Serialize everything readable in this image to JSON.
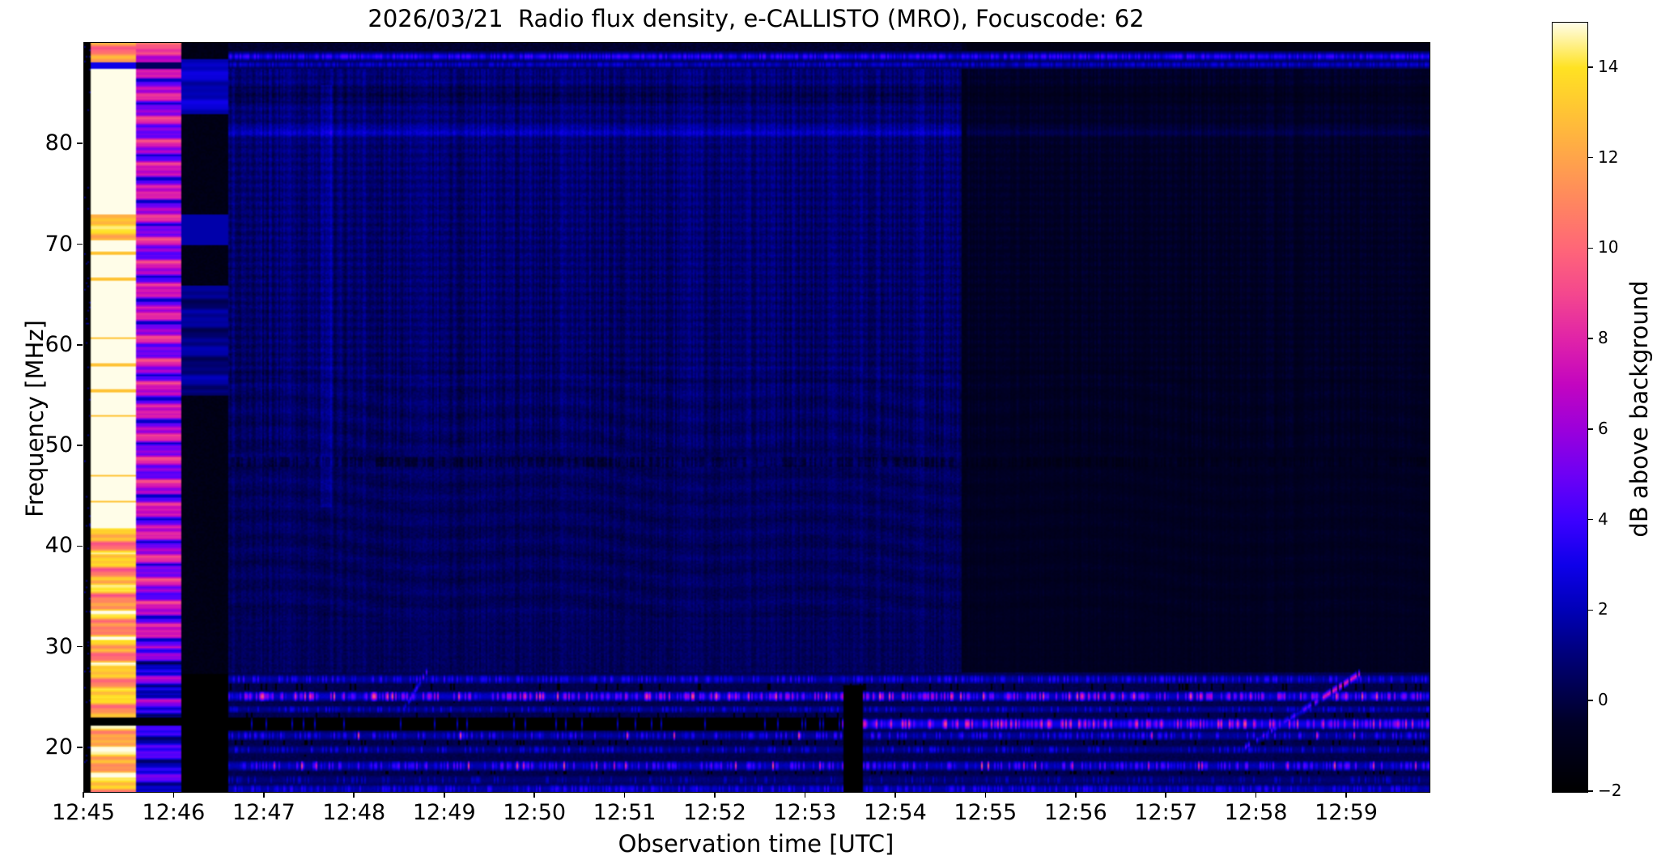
{
  "figure": {
    "title": "2026/03/21  Radio flux density, e-CALLISTO (MRO), Focuscode: 62",
    "xlabel": "Observation time [UTC]",
    "ylabel": "Frequency [MHz]"
  },
  "chart_data": {
    "type": "heatmap",
    "subtype": "radio-spectrogram",
    "title": "2026/03/21  Radio flux density, e-CALLISTO (MRO), Focuscode: 62",
    "xlabel": "Observation time [UTC]",
    "ylabel": "Frequency [MHz]",
    "x_ticks": [
      "12:45",
      "12:46",
      "12:47",
      "12:48",
      "12:49",
      "12:50",
      "12:51",
      "12:52",
      "12:53",
      "12:54",
      "12:55",
      "12:56",
      "12:57",
      "12:58",
      "12:59"
    ],
    "x_start": "12:45:00",
    "x_end": "12:59:56",
    "x_span_minutes": 14.93,
    "y_ticks": [
      20,
      30,
      40,
      50,
      60,
      70,
      80
    ],
    "ylim_mhz": [
      15.7,
      90.1
    ],
    "grid": false,
    "colorbar": {
      "label": "dB above background",
      "ticks": [
        14,
        12,
        10,
        8,
        6,
        4,
        2,
        0,
        -2
      ],
      "vmin": -2,
      "vmax": 15,
      "colormap": [
        {
          "v": -2.0,
          "c": "#000000"
        },
        {
          "v": -0.5,
          "c": "#000026"
        },
        {
          "v": 0.0,
          "c": "#000041"
        },
        {
          "v": 1.0,
          "c": "#000078"
        },
        {
          "v": 2.0,
          "c": "#0000b6"
        },
        {
          "v": 3.0,
          "c": "#0e00e9"
        },
        {
          "v": 4.0,
          "c": "#3c00ff"
        },
        {
          "v": 5.0,
          "c": "#6d00f5"
        },
        {
          "v": 6.0,
          "c": "#9b00db"
        },
        {
          "v": 7.0,
          "c": "#c305c0"
        },
        {
          "v": 8.0,
          "c": "#e023a8"
        },
        {
          "v": 9.0,
          "c": "#f4478e"
        },
        {
          "v": 10.0,
          "c": "#ff6678"
        },
        {
          "v": 11.0,
          "c": "#ff8560"
        },
        {
          "v": 12.0,
          "c": "#ffa44a"
        },
        {
          "v": 13.0,
          "c": "#ffc335"
        },
        {
          "v": 14.0,
          "c": "#ffe222"
        },
        {
          "v": 15.0,
          "c": "#fffde8"
        }
      ]
    },
    "features": {
      "edge_black_strip": {
        "t0": 0.0,
        "t1": 0.08,
        "db": -2
      },
      "calibration_columns": [
        {
          "t0": 0.08,
          "t1": 0.574,
          "kind": "saturated",
          "db_range": [
            9,
            15
          ],
          "note": "white/yellow banded column"
        },
        {
          "t0": 0.574,
          "t1": 1.077,
          "kind": "warm",
          "db_range": [
            2.5,
            11
          ],
          "note": "pink/magenta banded column"
        },
        {
          "t0": 1.077,
          "t1": 1.607,
          "kind": "dark",
          "db_range": [
            -2,
            2.4
          ],
          "note": "near-black column with blue bands"
        }
      ],
      "cal_black_gap_mhz": [
        22.3,
        23.15
      ],
      "background_db": {
        "low_freq": 0.2,
        "high_freq": 0.9
      },
      "dim_after_min": 9.79,
      "dim_factor": 0.52,
      "seam": {
        "t0": 9.73,
        "t1": 9.8,
        "db": -1.1
      },
      "top_lines": [
        {
          "f": 88.75,
          "w": 0.35,
          "amp": 3.3
        },
        {
          "f": 87.95,
          "w": 0.3,
          "amp": 2.2
        }
      ],
      "dark_band_mhz": {
        "f0": 84.2,
        "f1": 85.8,
        "delta": -0.55
      },
      "line_813": {
        "f": 81.3,
        "w": 0.5,
        "amp": 1.3
      },
      "dotted_dark_line_mhz": 48.5,
      "vertical_streak": {
        "t0": 2.62,
        "t1": 2.74,
        "f0": 44,
        "f1": 86,
        "delta": 0.8
      },
      "rfi_rows": [
        {
          "f": 26.9,
          "w": 0.5,
          "amp": 1.5,
          "p": 0.5,
          "burst": 2.5,
          "pink": 0.0
        },
        {
          "f": 25.2,
          "w": 0.55,
          "amp": 2.2,
          "p": 0.55,
          "burst": 4.5,
          "pink": 0.06
        },
        {
          "f": 23.9,
          "w": 0.4,
          "amp": 1.2,
          "p": 0.4,
          "burst": 2.0,
          "pink": 0.0
        },
        {
          "f": 21.3,
          "w": 0.5,
          "amp": 1.4,
          "p": 0.45,
          "burst": 2.6,
          "pink": 0.01
        },
        {
          "f": 19.9,
          "w": 0.45,
          "amp": 1.1,
          "p": 0.4,
          "burst": 2.2,
          "pink": 0.0
        },
        {
          "f": 18.3,
          "w": 0.55,
          "amp": 1.8,
          "p": 0.5,
          "burst": 3.2,
          "pink": 0.04
        },
        {
          "f": 16.9,
          "w": 0.5,
          "amp": 0.8,
          "p": 0.3,
          "burst": 1.6,
          "pink": 0.0
        },
        {
          "f": 16.0,
          "w": 0.5,
          "amp": 1.6,
          "p": 0.6,
          "burst": 2.2,
          "pink": 0.0
        }
      ],
      "band_2245": {
        "f": 22.45,
        "w": 0.62,
        "black_until_min": 8.4,
        "bright_db": [
          3,
          8.5
        ]
      },
      "black_blob": {
        "t0": 8.42,
        "t1": 8.64,
        "f_max": 26.3
      },
      "black_patch_centers_mhz": [
        17.3,
        20.6,
        23.3,
        25.9
      ],
      "drifting_bursts": [
        {
          "t0": 3.54,
          "t1": 3.8,
          "f0": 23.8,
          "f1": 27.6,
          "amp": 4.5,
          "bright_tip": false
        },
        {
          "t0": 12.88,
          "t1": 14.15,
          "f0": 20.1,
          "f1": 27.4,
          "amp": 4.0,
          "bright_tip": true
        }
      ]
    }
  }
}
